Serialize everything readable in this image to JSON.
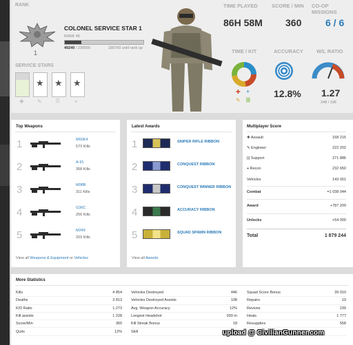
{
  "rank": {
    "header": "RANK",
    "title": "COLONEL SERVICE STAR 1",
    "rank_label": "RANK 46",
    "xp": "49240",
    "xp_total": "/ 230000",
    "xp_remaining": "180760 until rank up",
    "insignia_number": "1"
  },
  "service_stars": {
    "header": "SERVICE STARS",
    "icons": [
      "star",
      "star",
      "star",
      "star"
    ]
  },
  "stats_top": {
    "time_played_label": "TIME PLAYED",
    "time_played": "86H 58M",
    "score_min_label": "SCORE / MIN",
    "score_min": "360",
    "coop_label": "CO-OP MISSIONS",
    "coop": "6 / 6",
    "time_kit_label": "TIME / KIT",
    "accuracy_label": "ACCURACY",
    "accuracy": "12.8%",
    "wl_label": "W/L RATIO",
    "wl": "1.27",
    "wl_detail": "248 / 196",
    "colors": {
      "assault": "#c84b27",
      "engineer": "#d8a92a",
      "support": "#7ab33c",
      "recon": "#2a8ec8"
    }
  },
  "top_weapons": {
    "title": "Top Weapons",
    "items": [
      {
        "num": "1",
        "name": "M60E4",
        "kills": "573 Kills"
      },
      {
        "num": "2",
        "name": "A-91",
        "kills": "358 Kills"
      },
      {
        "num": "3",
        "name": "M98B",
        "kills": "311 Kills"
      },
      {
        "num": "4",
        "name": "G36C",
        "kills": "256 Kills"
      },
      {
        "num": "5",
        "name": "M249",
        "kills": "203 Kills"
      }
    ],
    "footer_prefix": "View all",
    "footer_link1": "Weapons & Equipment",
    "footer_or": "or",
    "footer_link2": "Vehicles"
  },
  "latest_awards": {
    "title": "Latest Awards",
    "items": [
      {
        "num": "1",
        "name": "SNIPER RIFLE RIBBON"
      },
      {
        "num": "2",
        "name": "CONQUEST RIBBON"
      },
      {
        "num": "3",
        "name": "CONQUEST WINNER RIBBON"
      },
      {
        "num": "4",
        "name": "ACCURACY RIBBON"
      },
      {
        "num": "5",
        "name": "SQUAD SPAWN RIBBON"
      }
    ],
    "footer_prefix": "View all",
    "footer_link": "Awards"
  },
  "multiplayer_score": {
    "title": "Multiplayer Score",
    "assault_label": "Assault",
    "assault": "168 215",
    "engineer_label": "Engineer",
    "engineer": "222 202",
    "support_label": "Support",
    "support": "271 886",
    "recon_label": "Recon",
    "recon": "232 650",
    "vehicles_label": "Vehicles",
    "vehicles": "143 001",
    "combat_label": "Combat",
    "combat": "=1 038 044",
    "award_label": "Award",
    "award": "+787 200",
    "unlocks_label": "Unlocks",
    "unlocks": "+54 000",
    "total_label": "Total",
    "total": "1 879 244"
  },
  "more_stats": {
    "title": "More Statistics",
    "col1": [
      {
        "label": "Kills",
        "value": "4 854"
      },
      {
        "label": "Deaths",
        "value": "3 813"
      },
      {
        "label": "K/D Ratio",
        "value": "1.273"
      },
      {
        "label": "Kill assists",
        "value": "1 228"
      },
      {
        "label": "Score/Min",
        "value": "360"
      },
      {
        "label": "Quits",
        "value": "12%"
      }
    ],
    "col2": [
      {
        "label": "Vehicles Destroyed",
        "value": "446"
      },
      {
        "label": "Vehicles Destroyed Assists",
        "value": "108"
      },
      {
        "label": "Avg. Weapon Accuracy",
        "value": "12%"
      },
      {
        "label": "Longest Headshot",
        "value": "930 m"
      },
      {
        "label": "Kill Streak Bonus",
        "value": "18"
      },
      {
        "label": "Skill",
        "value": "458"
      }
    ],
    "col3": [
      {
        "label": "Squad Score Bonus",
        "value": "39 910"
      },
      {
        "label": "Repairs",
        "value": "19"
      },
      {
        "label": "Revives",
        "value": "239"
      },
      {
        "label": "Heals",
        "value": "1 777"
      },
      {
        "label": "Resupplies",
        "value": "558"
      },
      {
        "label": "",
        "value": ""
      }
    ]
  },
  "watermark": "upload @ CivilianGunner.com"
}
